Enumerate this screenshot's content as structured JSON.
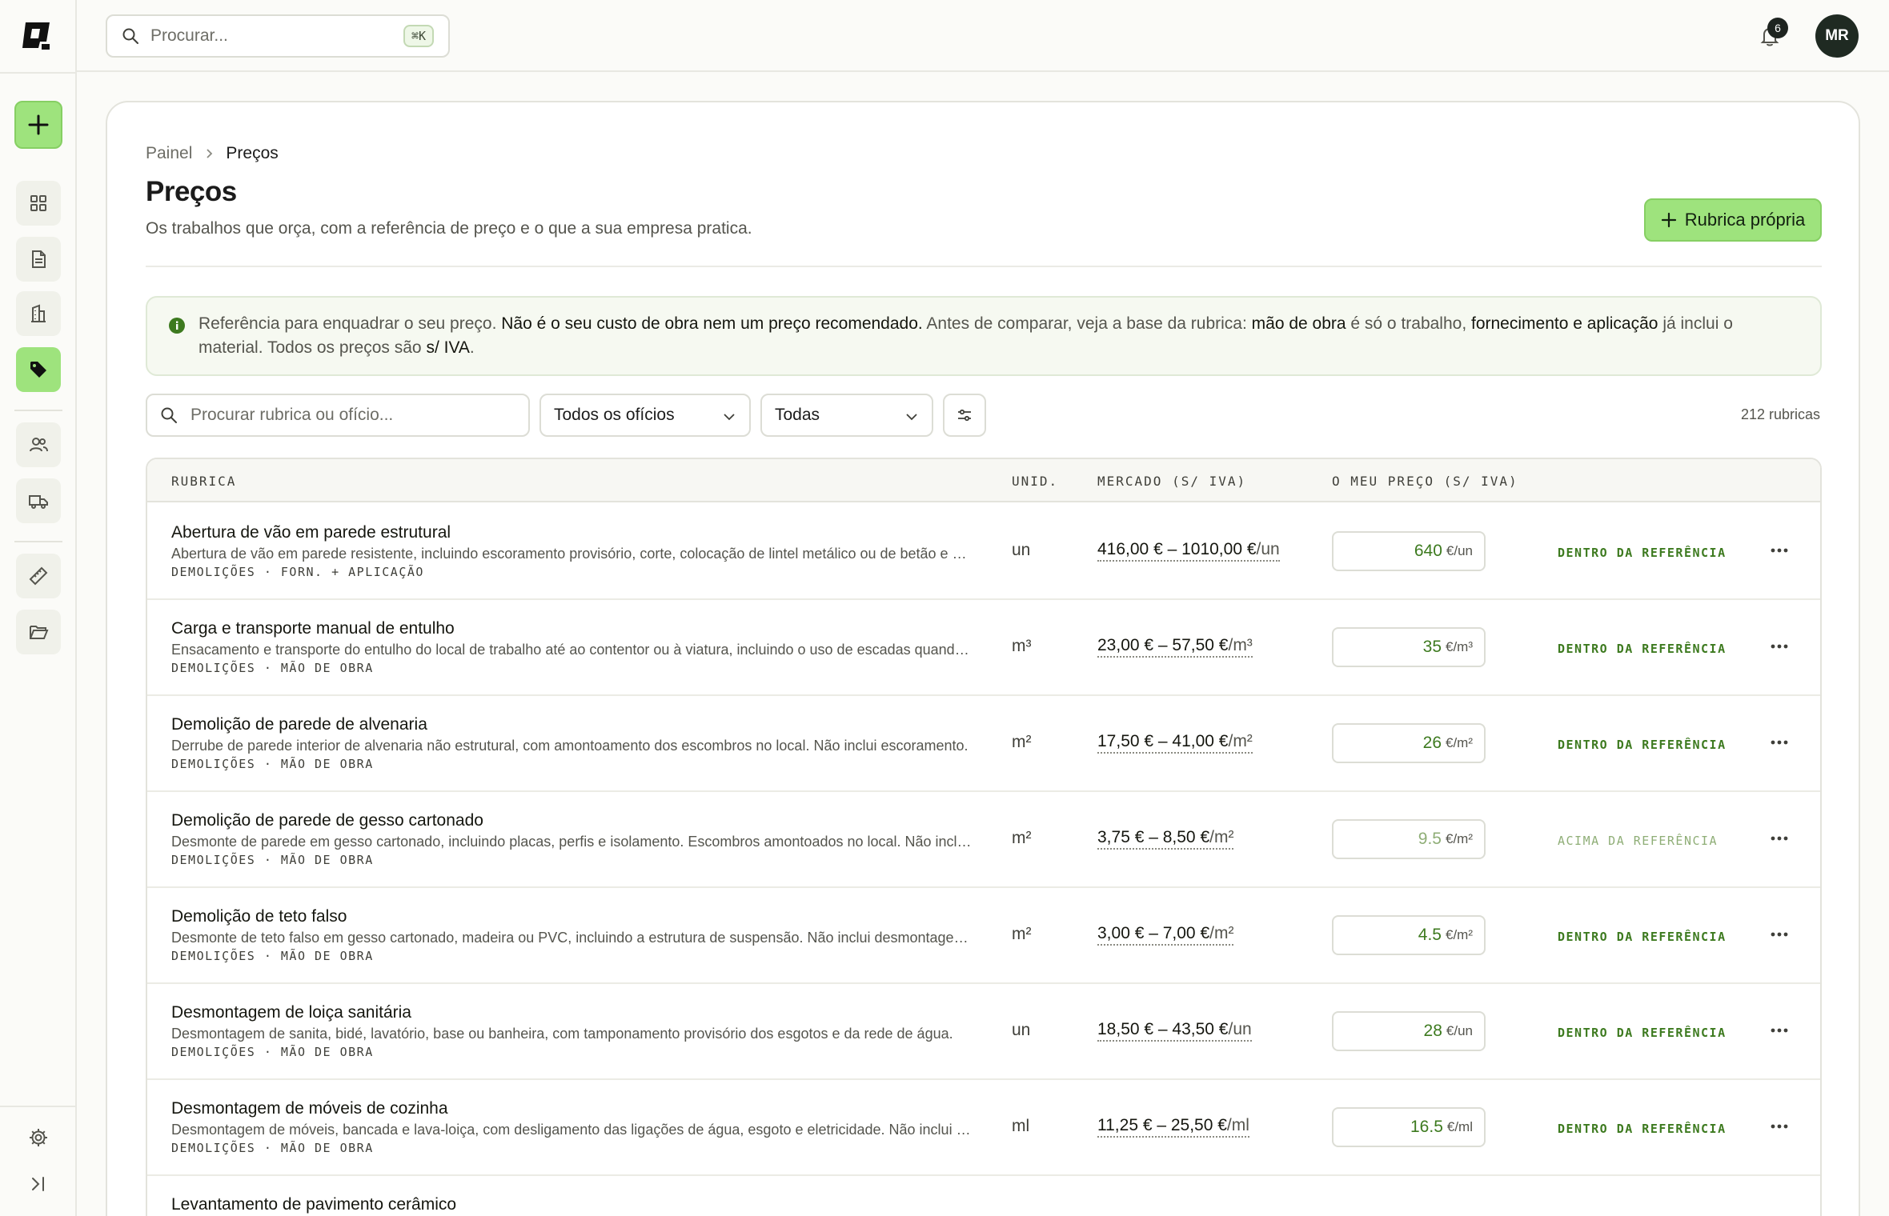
{
  "colors": {
    "accent": "#9ee37d",
    "accent_text": "#3d7a1f",
    "muted_accent": "#8fae77"
  },
  "sidebar": {
    "logo_icon": "app-logo",
    "add_icon": "plus-icon",
    "nav": [
      {
        "icon": "dashboard-grid-icon"
      },
      {
        "icon": "document-icon"
      },
      {
        "icon": "building-icon"
      },
      {
        "icon": "price-tag-icon",
        "active": true
      },
      {
        "icon": "users-icon"
      },
      {
        "icon": "truck-icon"
      },
      {
        "icon": "ruler-icon"
      },
      {
        "icon": "folder-icon"
      }
    ],
    "bottom": [
      {
        "icon": "settings-gear-icon"
      },
      {
        "icon": "collapse-sidebar-icon"
      }
    ]
  },
  "topbar": {
    "search_placeholder": "Procurar...",
    "search_shortcut": "⌘K",
    "notifications_count": "6",
    "avatar_initials": "MR"
  },
  "breadcrumb": {
    "parent": "Painel",
    "current": "Preços"
  },
  "page": {
    "title": "Preços",
    "subtitle": "Os trabalhos que orça, com a referência de preço e o que a sua empresa pratica.",
    "own_button": "Rubrica própria"
  },
  "info_banner": {
    "t1": "Referência para enquadrar o seu preço. ",
    "b1": "Não é o seu custo de obra nem um preço recomendado.",
    "t2": " Antes de comparar, veja a base da rubrica: ",
    "b2": "mão de obra",
    "t3": " é só o trabalho, ",
    "b3": "fornecimento e aplicação",
    "t4": " já inclui o material. Todos os preços são ",
    "b4": "s/ IVA",
    "t5": "."
  },
  "filters": {
    "search_placeholder": "Procurar rubrica ou ofício...",
    "trade_select": "Todos os ofícios",
    "status_select": "Todas",
    "count": "212 rubricas"
  },
  "table": {
    "headers": {
      "item": "RUBRICA",
      "unit": "UNID.",
      "market": "MERCADO (S/ IVA)",
      "my_price": "O MEU PREÇO (S/ IVA)"
    },
    "rows": [
      {
        "name": "Abertura de vão em parede estrutural",
        "desc": "Abertura de vão em parede resistente, incluindo escoramento provisório, corte, colocação de lintel metálico ou de betão e acabamento das arestas.",
        "tags": "DEMOLIÇÕES · FORN. + APLICAÇÃO",
        "unit": "un",
        "market": "416,00 € – 1010,00 €",
        "market_unit": "/un",
        "price": "640",
        "price_unit": "€/un",
        "status": "DENTRO DA REFERÊNCIA",
        "above": false
      },
      {
        "name": "Carga e transporte manual de entulho",
        "desc": "Ensacamento e transporte do entulho do local de trabalho até ao contentor ou à viatura, incluindo o uso de escadas quando necessário.",
        "tags": "DEMOLIÇÕES · MÃO DE OBRA",
        "unit": "m³",
        "market": "23,00 € – 57,50 €",
        "market_unit": "/m³",
        "price": "35",
        "price_unit": "€/m³",
        "status": "DENTRO DA REFERÊNCIA",
        "above": false
      },
      {
        "name": "Demolição de parede de alvenaria",
        "desc": "Derrube de parede interior de alvenaria não estrutural, com amontoamento dos escombros no local. Não inclui escoramento.",
        "tags": "DEMOLIÇÕES · MÃO DE OBRA",
        "unit": "m²",
        "market": "17,50 € – 41,00 €",
        "market_unit": "/m²",
        "price": "26",
        "price_unit": "€/m²",
        "status": "DENTRO DA REFERÊNCIA",
        "above": false
      },
      {
        "name": "Demolição de parede de gesso cartonado",
        "desc": "Desmonte de parede em gesso cartonado, incluindo placas, perfis e isolamento. Escombros amontoados no local. Não inclui transporte.",
        "tags": "DEMOLIÇÕES · MÃO DE OBRA",
        "unit": "m²",
        "market": "3,75 € – 8,50 €",
        "market_unit": "/m²",
        "price": "9.5",
        "price_unit": "€/m²",
        "status": "ACIMA DA REFERÊNCIA",
        "above": true
      },
      {
        "name": "Demolição de teto falso",
        "desc": "Desmonte de teto falso em gesso cartonado, madeira ou PVC, incluindo a estrutura de suspensão. Não inclui desmontagem de luminárias.",
        "tags": "DEMOLIÇÕES · MÃO DE OBRA",
        "unit": "m²",
        "market": "3,00 € – 7,00 €",
        "market_unit": "/m²",
        "price": "4.5",
        "price_unit": "€/m²",
        "status": "DENTRO DA REFERÊNCIA",
        "above": false
      },
      {
        "name": "Desmontagem de loiça sanitária",
        "desc": "Desmontagem de sanita, bidé, lavatório, base ou banheira, com tamponamento provisório dos esgotos e da rede de água.",
        "tags": "DEMOLIÇÕES · MÃO DE OBRA",
        "unit": "un",
        "market": "18,50 € – 43,50 €",
        "market_unit": "/un",
        "price": "28",
        "price_unit": "€/un",
        "status": "DENTRO DA REFERÊNCIA",
        "above": false
      },
      {
        "name": "Desmontagem de móveis de cozinha",
        "desc": "Desmontagem de móveis, bancada e lava-loiça, com desligamento das ligações de água, esgoto e eletricidade. Não inclui transporte.",
        "tags": "DEMOLIÇÕES · MÃO DE OBRA",
        "unit": "ml",
        "market": "11,25 € – 25,50 €",
        "market_unit": "/ml",
        "price": "16.5",
        "price_unit": "€/ml",
        "status": "DENTRO DA REFERÊNCIA",
        "above": false
      },
      {
        "name": "Levantamento de pavimento cerâmico",
        "desc": "",
        "tags": "",
        "unit": "",
        "market": "",
        "market_unit": "",
        "price": "",
        "price_unit": "",
        "status": "",
        "above": false
      }
    ]
  }
}
